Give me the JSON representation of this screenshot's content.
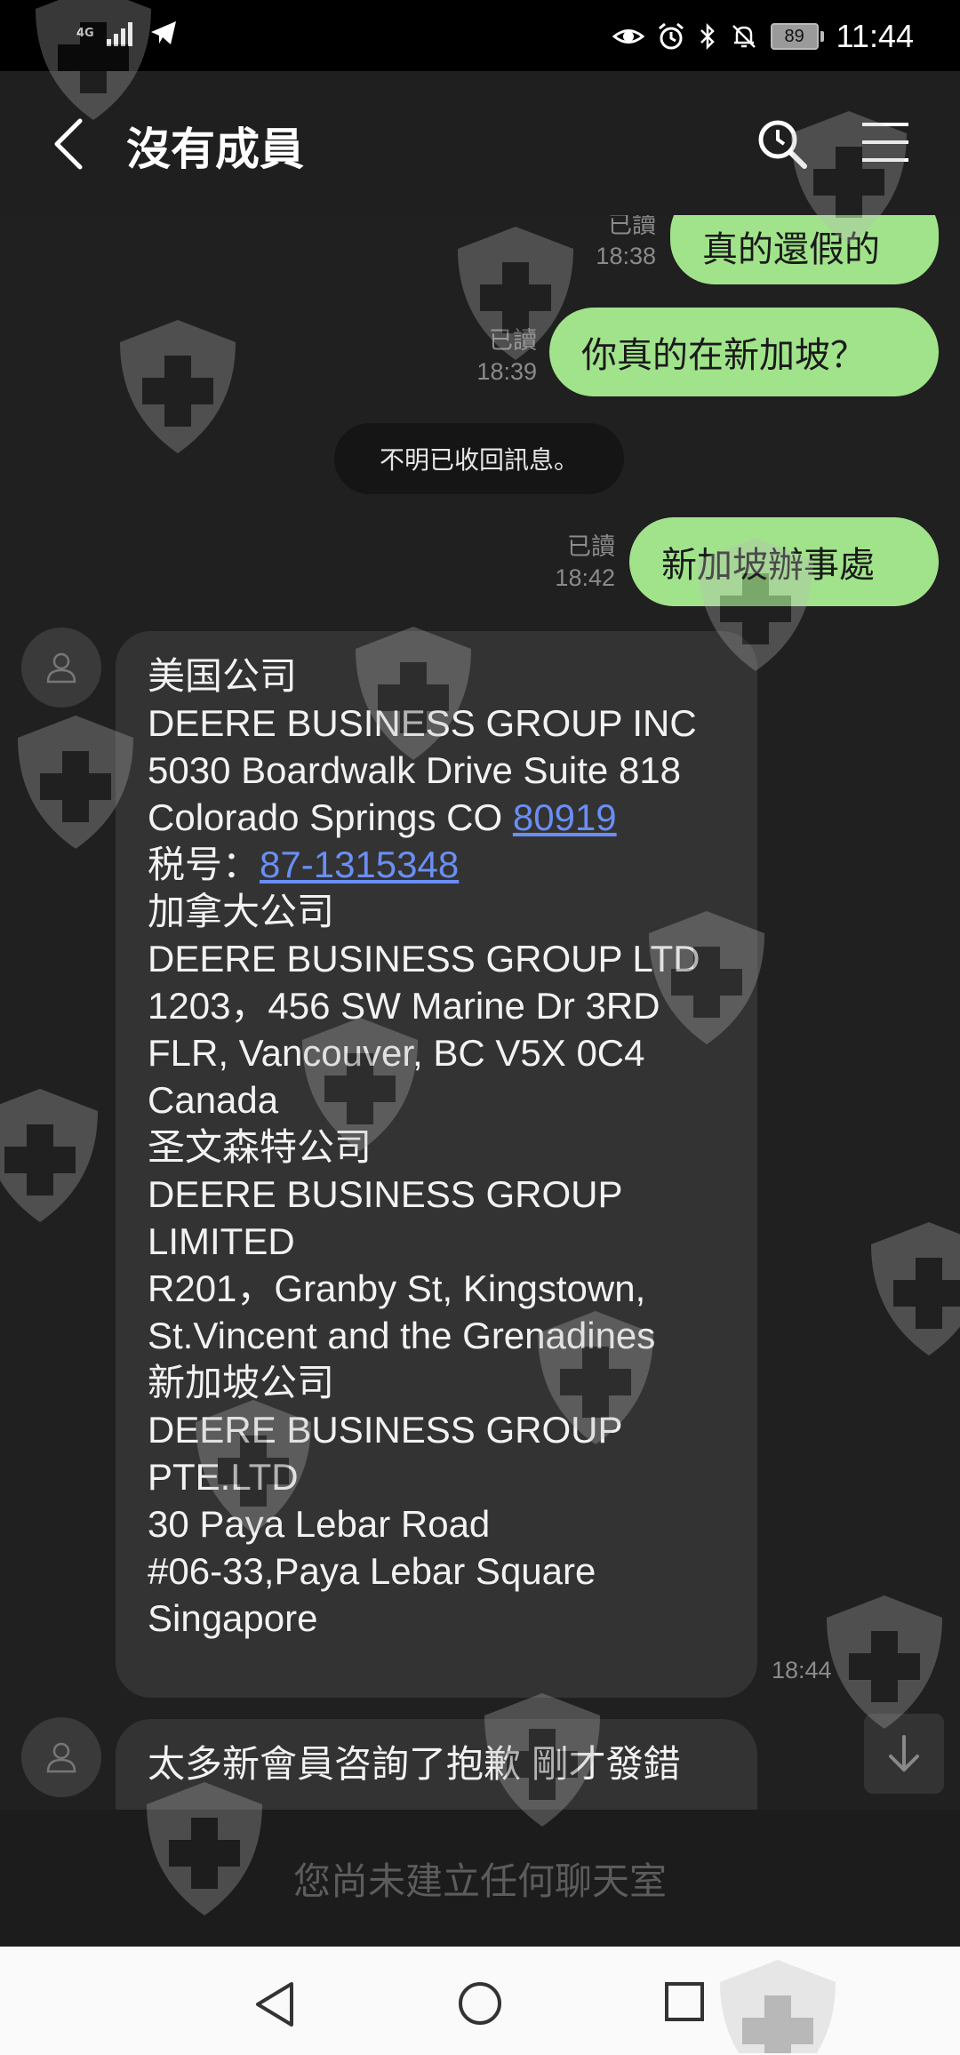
{
  "status_bar": {
    "network": "4G",
    "time": "11:44",
    "battery": "89"
  },
  "header": {
    "title": "沒有成員"
  },
  "messages": [
    {
      "read": "已讀",
      "time": "18:38",
      "text": "真的還假的"
    },
    {
      "read": "已讀",
      "time": "18:39",
      "text": "你真的在新加坡？"
    },
    {
      "read": "已讀",
      "time": "18:42",
      "text": "新加坡辦事處"
    }
  ],
  "system_notice": "不明已收回訊息。",
  "incoming1": {
    "time": "18:44",
    "lines": [
      "美国公司",
      "DEERE BUSINESS GROUP INC",
      "5030 Boardwalk Drive Suite 818",
      "Colorado Springs CO ",
      "80919",
      "税号：",
      "87-1315348",
      "加拿大公司",
      "DEERE BUSINESS GROUP LTD",
      "1203，456 SW Marine Dr 3RD",
      "FLR, Vancouver, BC V5X 0C4",
      "Canada",
      "圣文森特公司",
      "DEERE BUSINESS GROUP",
      "LIMITED",
      "R201，Granby St, Kingstown,",
      "St.Vincent and the Grenadines",
      "新加坡公司",
      "DEERE BUSINESS GROUP",
      "PTE.LTD",
      "30 Paya Lebar Road",
      "#06-33,Paya Lebar Square",
      "Singapore"
    ]
  },
  "incoming2": {
    "text": "太多新會員咨詢了抱歉 剛才發錯"
  },
  "composer": {
    "placeholder": "您尚未建立任何聊天室"
  },
  "colors": {
    "outgoing_bubble": "#a1e38b",
    "incoming_bubble": "#333333",
    "link": "#6a8ef5",
    "background": "#202020"
  }
}
